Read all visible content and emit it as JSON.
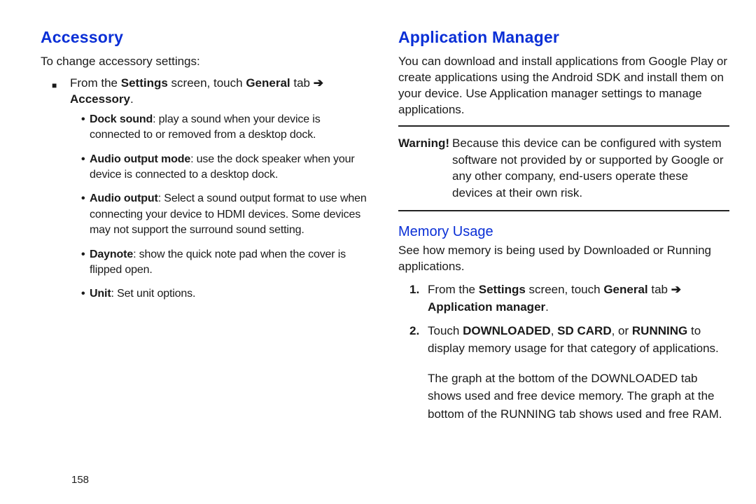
{
  "left": {
    "heading": "Accessory",
    "intro": "To change accessory settings:",
    "step_prefix": "From the ",
    "step_settings": "Settings",
    "step_mid": " screen, touch ",
    "step_general": "General",
    "step_tab": " tab ",
    "step_target": "Accessory",
    "period": ".",
    "bullets": [
      {
        "title": "Dock sound",
        "body": ": play a sound when your device is connected to or removed from a desktop dock."
      },
      {
        "title": "Audio output mode",
        "body": ": use the dock speaker when your device is connected to a desktop dock."
      },
      {
        "title": "Audio output",
        "body": ": Select a sound output format to use when connecting your device to HDMI devices. Some devices may not support the surround sound setting."
      },
      {
        "title": "Daynote",
        "body": ": show the quick note pad when the cover is flipped open."
      },
      {
        "title": "Unit",
        "body": ": Set unit options."
      }
    ]
  },
  "right": {
    "heading": "Application Manager",
    "intro": "You can download and install applications from Google Play or create applications using the Android SDK and install them on your device. Use Application manager settings to manage applications.",
    "warning_label": "Warning!",
    "warning_text": "Because this device can be configured with system software not provided by or supported by Google or any other company, end-users operate these devices at their own risk.",
    "sub": "Memory Usage",
    "sub_intro": "See how memory is being used by Downloaded or Running applications.",
    "steps": {
      "s1_prefix": "From the ",
      "s1_settings": "Settings",
      "s1_mid": " screen, touch ",
      "s1_general": "General",
      "s1_tab": " tab ",
      "s1_target": "Application manager",
      "period": ".",
      "s2_a": "Touch ",
      "s2_dl": "DOWNLOADED",
      "s2_c1": ", ",
      "s2_sd": "SD CARD",
      "s2_c2": ", or ",
      "s2_run": "RUNNING",
      "s2_end": " to display memory usage for that category of applications."
    },
    "trail": "The graph at the bottom of the DOWNLOADED tab shows used and free device memory. The graph at the bottom of the RUNNING tab shows used and free RAM."
  },
  "pagenum": "158",
  "markers": {
    "n1": "1.",
    "n2": "2."
  }
}
